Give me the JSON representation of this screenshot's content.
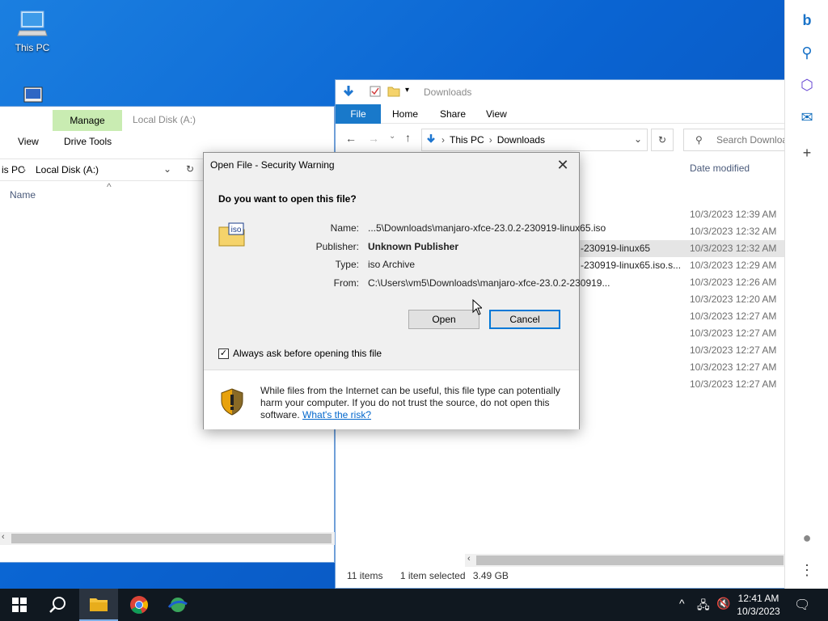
{
  "desktop": {
    "this_pc_label": "This PC"
  },
  "left_window": {
    "context_tab": "Manage",
    "context_title": "Local Disk (A:)",
    "tabs": [
      "View",
      "Drive Tools"
    ],
    "breadcrumb": [
      "is PC",
      "Local Disk (A:)"
    ],
    "column_name": "Name"
  },
  "right_window": {
    "title": "Downloads",
    "ribbon_tabs": [
      "File",
      "Home",
      "Share",
      "View"
    ],
    "breadcrumb": [
      "This PC",
      "Downloads"
    ],
    "search_placeholder": "Search Downloa",
    "column_date": "Date modified",
    "files": [
      {
        "name": "",
        "date": "10/3/2023 12:39 AM"
      },
      {
        "name": "",
        "date": "10/3/2023 12:32 AM"
      },
      {
        "name": "-230919-linux65",
        "date": "10/3/2023 12:32 AM"
      },
      {
        "name": "-230919-linux65.iso.s...",
        "date": "10/3/2023 12:29 AM"
      },
      {
        "name": "",
        "date": "10/3/2023 12:26 AM"
      },
      {
        "name": "",
        "date": "10/3/2023 12:20 AM"
      },
      {
        "name": "",
        "date": "10/3/2023 12:27 AM"
      },
      {
        "name": "",
        "date": "10/3/2023 12:27 AM"
      },
      {
        "name": "",
        "date": "10/3/2023 12:27 AM"
      },
      {
        "name": "",
        "date": "10/3/2023 12:27 AM"
      },
      {
        "name": "",
        "date": "10/3/2023 12:27 AM"
      }
    ],
    "selected_index": 2,
    "status": {
      "items": "11 items",
      "selected": "1 item selected",
      "size": "3.49 GB"
    }
  },
  "dialog": {
    "title": "Open File - Security Warning",
    "question": "Do you want to open this file?",
    "icon_label": "iso",
    "fields": [
      {
        "key": "Name:",
        "value": "...5\\Downloads\\manjaro-xfce-23.0.2-230919-linux65.iso",
        "bold": false
      },
      {
        "key": "Publisher:",
        "value": "Unknown Publisher",
        "bold": true
      },
      {
        "key": "Type:",
        "value": "iso Archive",
        "bold": false
      },
      {
        "key": "From:",
        "value": "C:\\Users\\vm5\\Downloads\\manjaro-xfce-23.0.2-230919...",
        "bold": false
      }
    ],
    "open_label": "Open",
    "cancel_label": "Cancel",
    "checkbox_label": "Always ask before opening this file",
    "checkbox_checked": true,
    "warning_text": "While files from the Internet can be useful, this file type can potentially harm your computer. If you do not trust the source, do not open this software.",
    "risk_link": "What's the risk?"
  },
  "taskbar": {
    "time": "12:41 AM",
    "date": "10/3/2023"
  },
  "colors": {
    "accent": "#0078d7",
    "file_tab": "#1979ca",
    "context_tab": "#c9ecb2",
    "taskbar": "#101820"
  }
}
